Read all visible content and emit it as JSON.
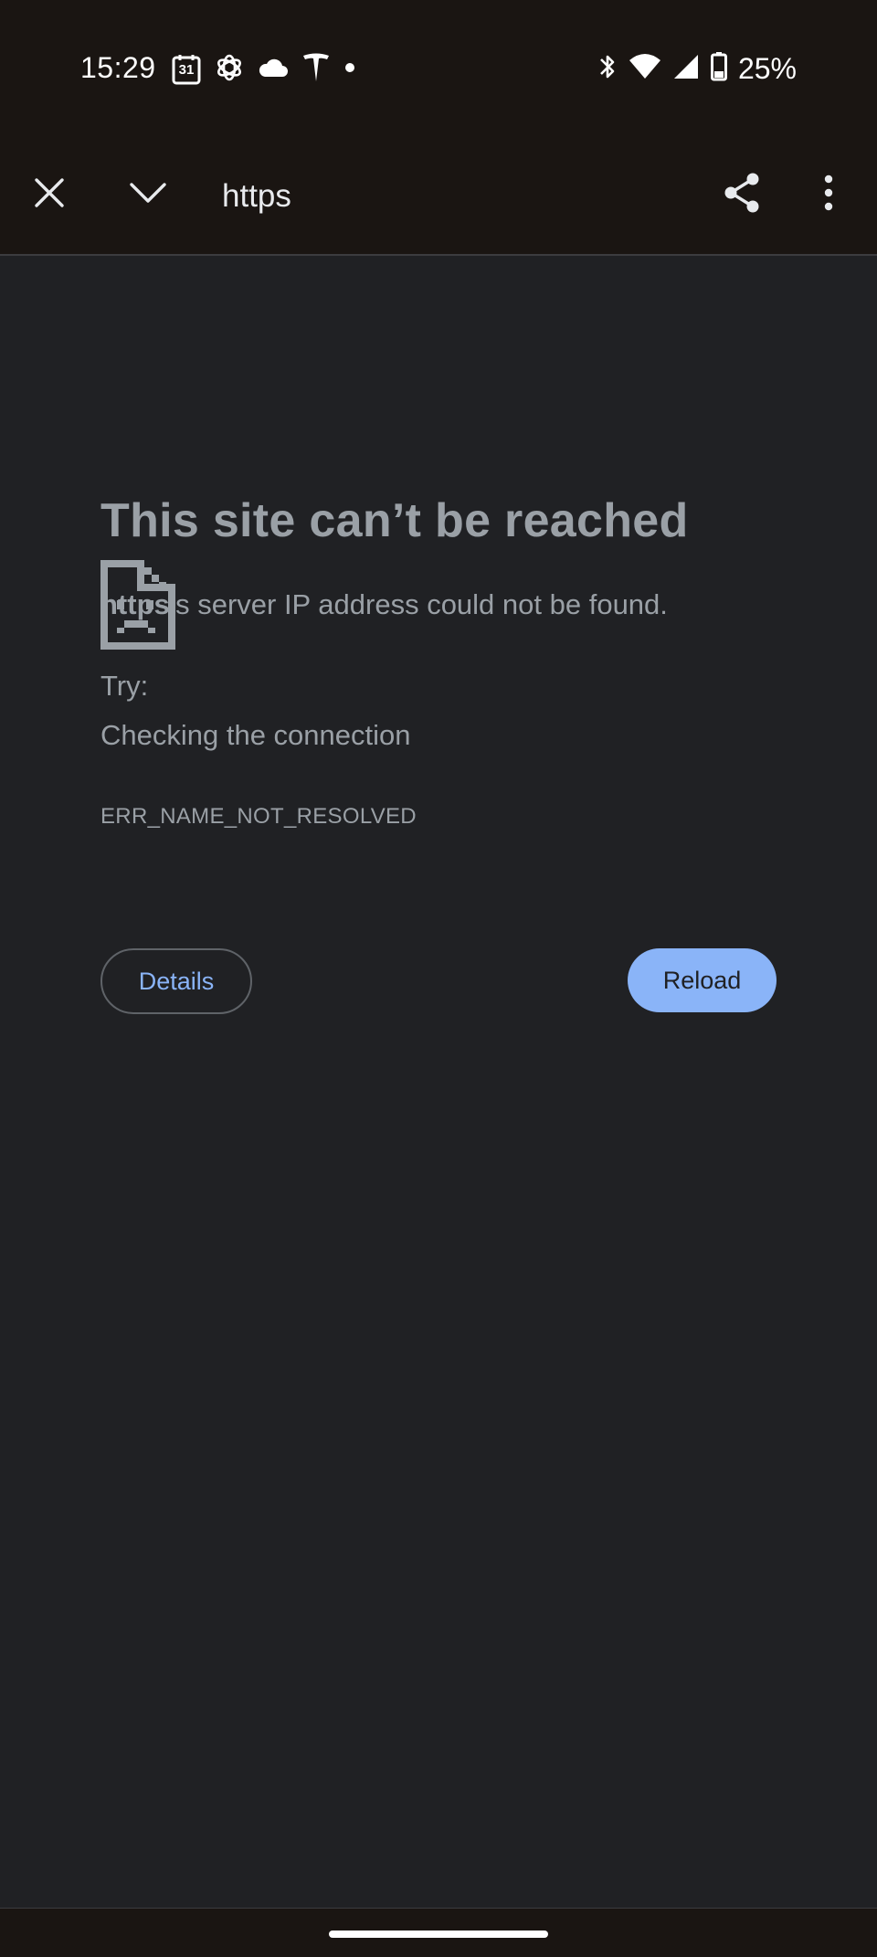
{
  "status_bar": {
    "time": "15:29",
    "calendar_day": "31",
    "battery": "25%",
    "icons": [
      "calendar-icon",
      "openai-icon",
      "cloud-icon",
      "tesla-icon",
      "notification-dot-icon",
      "bluetooth-icon",
      "wifi-icon",
      "signal-icon",
      "battery-icon"
    ]
  },
  "toolbar": {
    "url": "https",
    "icons": [
      "close-icon",
      "chevron-down-icon",
      "share-icon",
      "more-vert-icon"
    ]
  },
  "error_page": {
    "heading": "This site can’t be reached",
    "host": "https",
    "description_rest": "’s server IP address could not be found.",
    "try_label": "Try:",
    "suggestion": "Checking the connection",
    "error_code": "ERR_NAME_NOT_RESOLVED",
    "details_label": "Details",
    "reload_label": "Reload"
  },
  "colors": {
    "background": "#202124",
    "chrome_bar": "#1a1512",
    "text_muted": "#9aa0a6",
    "accent_blue": "#8ab4f8"
  }
}
